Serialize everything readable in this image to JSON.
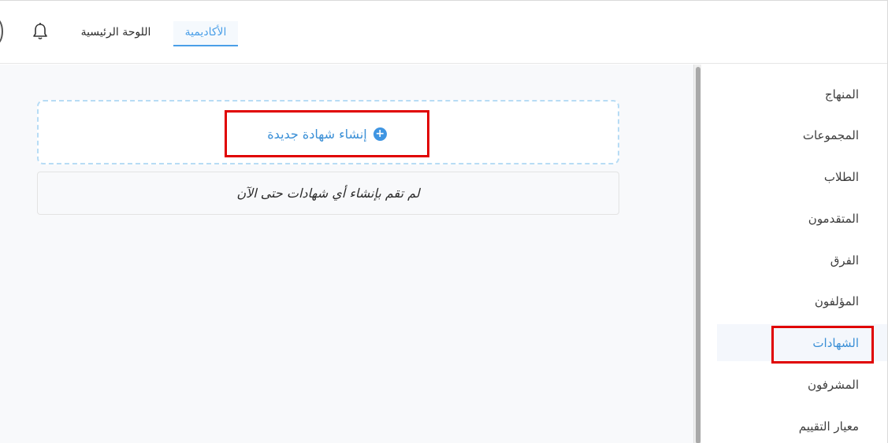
{
  "header": {
    "tabs": [
      {
        "label": "الأكاديمية",
        "active": true
      },
      {
        "label": "اللوحة الرئيسية",
        "active": false
      }
    ]
  },
  "main": {
    "create_button_label": "إنشاء شهادة جديدة",
    "empty_message": "لم تقم بإنشاء أي شهادات حتى الآن"
  },
  "sidebar": {
    "items": [
      {
        "label": "المنهاج",
        "active": false
      },
      {
        "label": "المجموعات",
        "active": false
      },
      {
        "label": "الطلاب",
        "active": false
      },
      {
        "label": "المتقدمون",
        "active": false
      },
      {
        "label": "الفرق",
        "active": false
      },
      {
        "label": "المؤلفون",
        "active": false
      },
      {
        "label": "الشهادات",
        "active": true
      },
      {
        "label": "المشرفون",
        "active": false
      },
      {
        "label": "معيار التقييم",
        "active": false
      }
    ]
  },
  "colors": {
    "accent": "#3a8fd6",
    "highlight": "#e00000"
  },
  "icons": {
    "bell": "bell-icon",
    "plus": "plus-circle-icon"
  }
}
